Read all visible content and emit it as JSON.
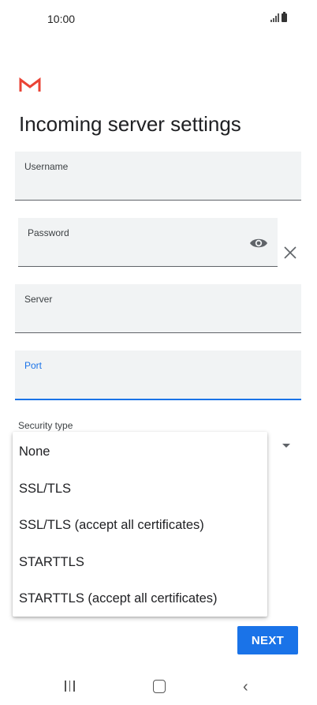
{
  "status_bar": {
    "time": "10:00"
  },
  "page": {
    "title": "Incoming server settings"
  },
  "fields": {
    "username": {
      "label": "Username",
      "value": ""
    },
    "password": {
      "label": "Password",
      "value": ""
    },
    "server": {
      "label": "Server",
      "value": ""
    },
    "port": {
      "label": "Port",
      "value": ""
    }
  },
  "security": {
    "label": "Security type",
    "options": [
      "None",
      "SSL/TLS",
      "SSL/TLS (accept all certificates)",
      "STARTTLS",
      "STARTTLS (accept all certificates)"
    ]
  },
  "buttons": {
    "next": "NEXT"
  },
  "icons": {
    "logo": "gmail-logo",
    "password_toggle": "eye-icon",
    "clear": "close-icon",
    "dropdown": "dropdown-arrow-icon"
  },
  "colors": {
    "accent": "#1a73e8",
    "field_bg": "#f1f3f4",
    "logo_red": "#ea4335"
  }
}
